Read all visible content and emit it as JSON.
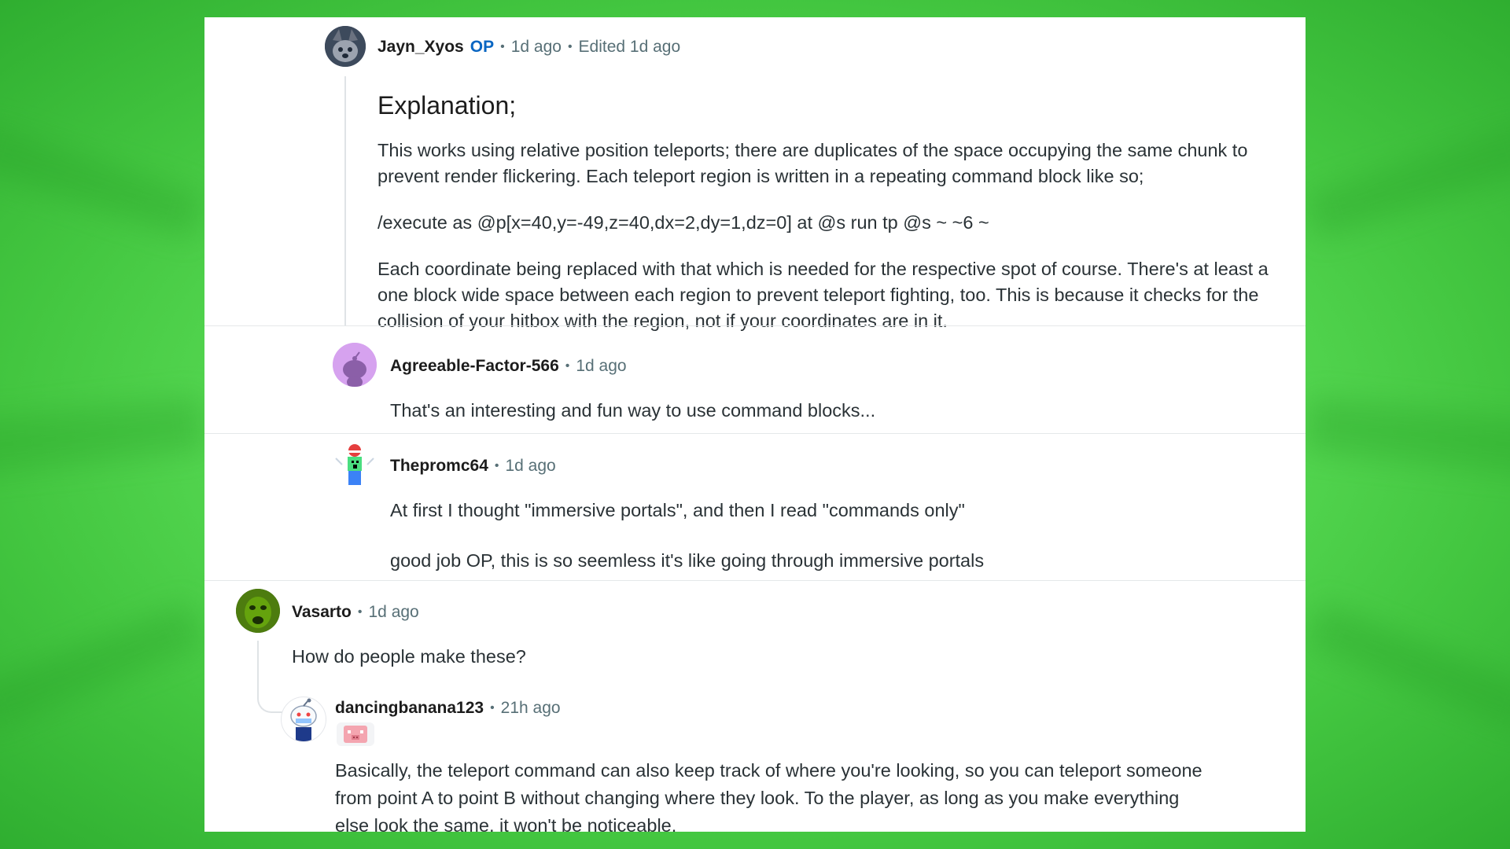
{
  "comments": [
    {
      "username": "Jayn_Xyos",
      "op_badge": "OP",
      "time": "1d ago",
      "edited": "Edited 1d ago",
      "heading": "Explanation;",
      "paragraphs": [
        "This works using relative position teleports; there are duplicates of the space occupying the same chunk to prevent render flickering. Each teleport region is written in a repeating command block like so;",
        "/execute as @p[x=40,y=-49,z=40,dx=2,dy=1,dz=0] at @s run tp @s ~ ~6 ~",
        "Each coordinate being replaced with that which is needed for the respective spot of course. There's at least a one block wide space between each region to prevent teleport fighting, too. This is because it checks for the collision of your hitbox with the region, not if your coordinates are in it."
      ]
    },
    {
      "username": "Agreeable-Factor-566",
      "time": "1d ago",
      "paragraphs": [
        "That's an interesting and fun way to use command blocks..."
      ]
    },
    {
      "username": "Thepromc64",
      "time": "1d ago",
      "paragraphs": [
        "At first I thought \"immersive portals\", and then I read \"commands only\"",
        "good job OP, this is so seemless it's like going through immersive portals"
      ]
    },
    {
      "username": "Vasarto",
      "time": "1d ago",
      "paragraphs": [
        "How do people make these?"
      ]
    },
    {
      "username": "dancingbanana123",
      "time": "21h ago",
      "paragraphs": [
        "Basically, the teleport command can also keep track of where you're looking, so you can teleport someone from point A to point B without changing where they look. To the player, as long as you make everything else look the same, it won't be noticeable."
      ]
    }
  ],
  "separator": "•",
  "colors": {
    "background_green": "#5ee05a",
    "op_blue": "#0a66c2",
    "meta_gray": "#576f76",
    "text": "#2a3236"
  }
}
